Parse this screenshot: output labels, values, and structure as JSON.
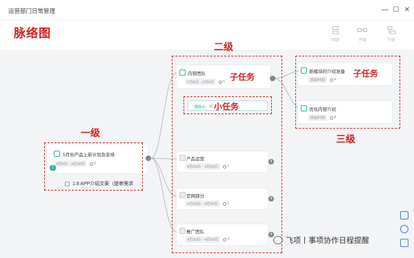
{
  "window": {
    "title": "运营部门日常管理",
    "min": "—",
    "max": "☐",
    "close": "✕"
  },
  "heading": "脉络图",
  "toolbar": [
    {
      "label": "同级",
      "icon": "sibling-icon"
    },
    {
      "label": "子级",
      "icon": "child-icon"
    },
    {
      "label": "下级",
      "icon": "subordinate-icon"
    }
  ],
  "annotations": {
    "level1": "一级",
    "level2": "二级",
    "level3": "三级",
    "subtask_a": "子任务",
    "subtask_b": "子任务",
    "small_task": "小任务"
  },
  "root": {
    "title": "5月份产品上新计划及安排",
    "date": "4月6日 - 4月30日",
    "members": "0",
    "badge": "1",
    "subtask": "1.8 APP介绍文案（提审需求"
  },
  "level2": [
    {
      "title": "内容团队",
      "date": "5月6日 - 5月6日",
      "members": "5",
      "badge": ""
    },
    {
      "title": "产品运营",
      "date": "4月20日 - 4月30日",
      "members": "1",
      "badge": "5"
    },
    {
      "title": "官网部分",
      "date": "4月20日 - 4月30日",
      "members": "2",
      "badge": "4"
    },
    {
      "title": "推广团队",
      "date": "4月20日 - 4月30日",
      "members": "3",
      "badge": "4"
    }
  ],
  "small_task": {
    "pill": "待办 ▾",
    "placeholder": "输"
  },
  "level3": [
    {
      "title": "新模块的介绍准备",
      "date": "添加时间",
      "members": "4"
    },
    {
      "title": "优化内容介绍",
      "date": "添加时间",
      "members": "4"
    }
  ],
  "watermark": "飞项丨事项协作日程提醒",
  "side_tools": [
    "layout-icon",
    "locate-icon",
    "fit-icon"
  ]
}
